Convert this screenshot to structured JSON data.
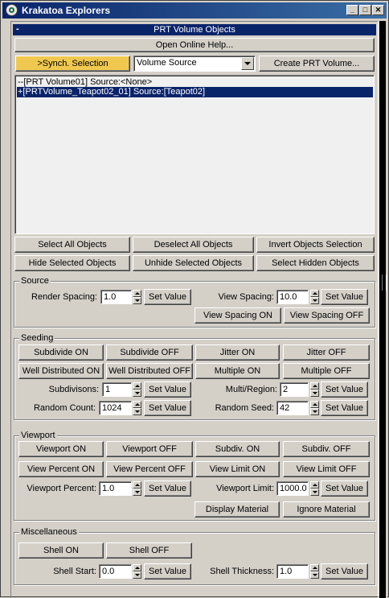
{
  "window": {
    "title": "Krakatoa Explorers"
  },
  "rollout": {
    "title": "PRT Volume Objects",
    "collapse_symbol": "-"
  },
  "top": {
    "help_button": "Open Online Help...",
    "sync_button": ">Synch. Selection",
    "source_select": "Volume Source",
    "create_button": "Create PRT Volume..."
  },
  "list": {
    "items": [
      {
        "text": "--[PRT Volume01]  Source:<None>",
        "selected": false
      },
      {
        "text": "+[PRTVolume_Teapot02_01]  Source:[Teapot02]",
        "selected": true
      }
    ]
  },
  "selection": {
    "select_all": "Select All Objects",
    "deselect_all": "Deselect All Objects",
    "invert": "Invert Objects Selection",
    "hide_selected": "Hide Selected Objects",
    "unhide_selected": "Unhide Selected Objects",
    "select_hidden": "Select Hidden Objects"
  },
  "source": {
    "title": "Source",
    "render_spacing_label": "Render Spacing:",
    "render_spacing": "1.0",
    "set_value": "Set Value",
    "view_spacing_label": "View Spacing:",
    "view_spacing": "10.0",
    "view_spacing_on": "View Spacing ON",
    "view_spacing_off": "View Spacing OFF"
  },
  "seeding": {
    "title": "Seeding",
    "subdivide_on": "Subdivide ON",
    "subdivide_off": "Subdivide OFF",
    "jitter_on": "Jitter ON",
    "jitter_off": "Jitter OFF",
    "well_on": "Well Distributed ON",
    "well_off": "Well Distributed OFF",
    "multiple_on": "Multiple ON",
    "multiple_off": "Multiple OFF",
    "subdivisions_label": "Subdivisons:",
    "subdivisions": "1",
    "multi_region_label": "Multi/Region:",
    "multi_region": "2",
    "random_count_label": "Random Count:",
    "random_count": "1024",
    "random_seed_label": "Random Seed:",
    "random_seed": "42",
    "set_value": "Set Value"
  },
  "viewport": {
    "title": "Viewport",
    "viewport_on": "Viewport ON",
    "viewport_off": "Viewport OFF",
    "subdiv_on": "Subdiv. ON",
    "subdiv_off": "Subdiv. OFF",
    "view_percent_on": "View Percent ON",
    "view_percent_off": "View Percent OFF",
    "view_limit_on": "View Limit ON",
    "view_limit_off": "View Limit OFF",
    "viewport_percent_label": "Viewport Percent:",
    "viewport_percent": "1.0",
    "viewport_limit_label": "Viewport Limit:",
    "viewport_limit": "1000.0",
    "display_material": "Display Material",
    "ignore_material": "Ignore Material",
    "set_value": "Set Value"
  },
  "misc": {
    "title": "Miscellaneous",
    "shell_on": "Shell ON",
    "shell_off": "Shell OFF",
    "shell_start_label": "Shell Start:",
    "shell_start": "0.0",
    "shell_thickness_label": "Shell Thickness:",
    "shell_thickness": "1.0",
    "set_value": "Set Value"
  },
  "colors": {
    "title_bar": "#0a246a",
    "selection": "#0a246a",
    "sync_button": "#f0c850",
    "face": "#d4d0c8"
  }
}
